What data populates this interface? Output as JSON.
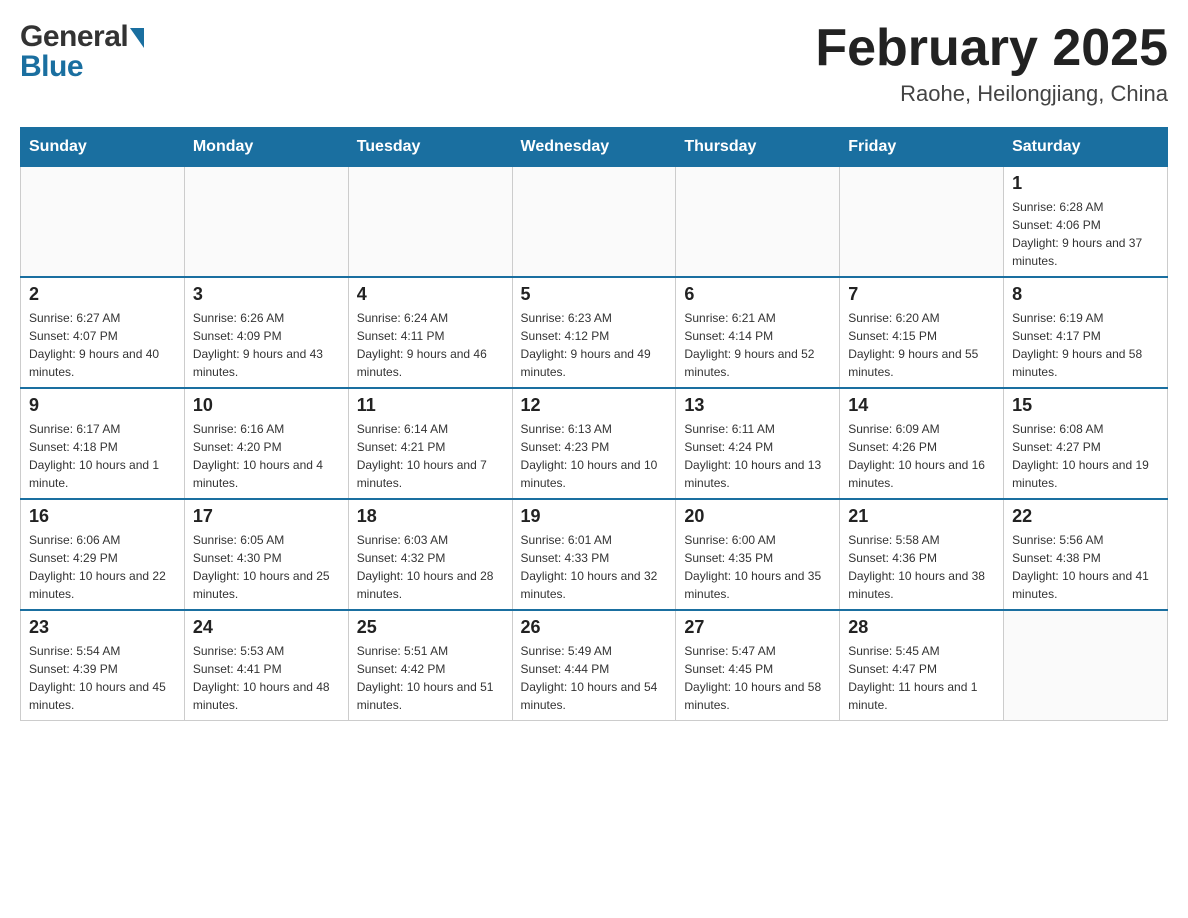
{
  "header": {
    "title": "February 2025",
    "subtitle": "Raohe, Heilongjiang, China",
    "logo_general": "General",
    "logo_blue": "Blue"
  },
  "days_of_week": [
    "Sunday",
    "Monday",
    "Tuesday",
    "Wednesday",
    "Thursday",
    "Friday",
    "Saturday"
  ],
  "weeks": [
    {
      "days": [
        {
          "date": "",
          "info": ""
        },
        {
          "date": "",
          "info": ""
        },
        {
          "date": "",
          "info": ""
        },
        {
          "date": "",
          "info": ""
        },
        {
          "date": "",
          "info": ""
        },
        {
          "date": "",
          "info": ""
        },
        {
          "date": "1",
          "info": "Sunrise: 6:28 AM\nSunset: 4:06 PM\nDaylight: 9 hours and 37 minutes."
        }
      ]
    },
    {
      "days": [
        {
          "date": "2",
          "info": "Sunrise: 6:27 AM\nSunset: 4:07 PM\nDaylight: 9 hours and 40 minutes."
        },
        {
          "date": "3",
          "info": "Sunrise: 6:26 AM\nSunset: 4:09 PM\nDaylight: 9 hours and 43 minutes."
        },
        {
          "date": "4",
          "info": "Sunrise: 6:24 AM\nSunset: 4:11 PM\nDaylight: 9 hours and 46 minutes."
        },
        {
          "date": "5",
          "info": "Sunrise: 6:23 AM\nSunset: 4:12 PM\nDaylight: 9 hours and 49 minutes."
        },
        {
          "date": "6",
          "info": "Sunrise: 6:21 AM\nSunset: 4:14 PM\nDaylight: 9 hours and 52 minutes."
        },
        {
          "date": "7",
          "info": "Sunrise: 6:20 AM\nSunset: 4:15 PM\nDaylight: 9 hours and 55 minutes."
        },
        {
          "date": "8",
          "info": "Sunrise: 6:19 AM\nSunset: 4:17 PM\nDaylight: 9 hours and 58 minutes."
        }
      ]
    },
    {
      "days": [
        {
          "date": "9",
          "info": "Sunrise: 6:17 AM\nSunset: 4:18 PM\nDaylight: 10 hours and 1 minute."
        },
        {
          "date": "10",
          "info": "Sunrise: 6:16 AM\nSunset: 4:20 PM\nDaylight: 10 hours and 4 minutes."
        },
        {
          "date": "11",
          "info": "Sunrise: 6:14 AM\nSunset: 4:21 PM\nDaylight: 10 hours and 7 minutes."
        },
        {
          "date": "12",
          "info": "Sunrise: 6:13 AM\nSunset: 4:23 PM\nDaylight: 10 hours and 10 minutes."
        },
        {
          "date": "13",
          "info": "Sunrise: 6:11 AM\nSunset: 4:24 PM\nDaylight: 10 hours and 13 minutes."
        },
        {
          "date": "14",
          "info": "Sunrise: 6:09 AM\nSunset: 4:26 PM\nDaylight: 10 hours and 16 minutes."
        },
        {
          "date": "15",
          "info": "Sunrise: 6:08 AM\nSunset: 4:27 PM\nDaylight: 10 hours and 19 minutes."
        }
      ]
    },
    {
      "days": [
        {
          "date": "16",
          "info": "Sunrise: 6:06 AM\nSunset: 4:29 PM\nDaylight: 10 hours and 22 minutes."
        },
        {
          "date": "17",
          "info": "Sunrise: 6:05 AM\nSunset: 4:30 PM\nDaylight: 10 hours and 25 minutes."
        },
        {
          "date": "18",
          "info": "Sunrise: 6:03 AM\nSunset: 4:32 PM\nDaylight: 10 hours and 28 minutes."
        },
        {
          "date": "19",
          "info": "Sunrise: 6:01 AM\nSunset: 4:33 PM\nDaylight: 10 hours and 32 minutes."
        },
        {
          "date": "20",
          "info": "Sunrise: 6:00 AM\nSunset: 4:35 PM\nDaylight: 10 hours and 35 minutes."
        },
        {
          "date": "21",
          "info": "Sunrise: 5:58 AM\nSunset: 4:36 PM\nDaylight: 10 hours and 38 minutes."
        },
        {
          "date": "22",
          "info": "Sunrise: 5:56 AM\nSunset: 4:38 PM\nDaylight: 10 hours and 41 minutes."
        }
      ]
    },
    {
      "days": [
        {
          "date": "23",
          "info": "Sunrise: 5:54 AM\nSunset: 4:39 PM\nDaylight: 10 hours and 45 minutes."
        },
        {
          "date": "24",
          "info": "Sunrise: 5:53 AM\nSunset: 4:41 PM\nDaylight: 10 hours and 48 minutes."
        },
        {
          "date": "25",
          "info": "Sunrise: 5:51 AM\nSunset: 4:42 PM\nDaylight: 10 hours and 51 minutes."
        },
        {
          "date": "26",
          "info": "Sunrise: 5:49 AM\nSunset: 4:44 PM\nDaylight: 10 hours and 54 minutes."
        },
        {
          "date": "27",
          "info": "Sunrise: 5:47 AM\nSunset: 4:45 PM\nDaylight: 10 hours and 58 minutes."
        },
        {
          "date": "28",
          "info": "Sunrise: 5:45 AM\nSunset: 4:47 PM\nDaylight: 11 hours and 1 minute."
        },
        {
          "date": "",
          "info": ""
        }
      ]
    }
  ]
}
